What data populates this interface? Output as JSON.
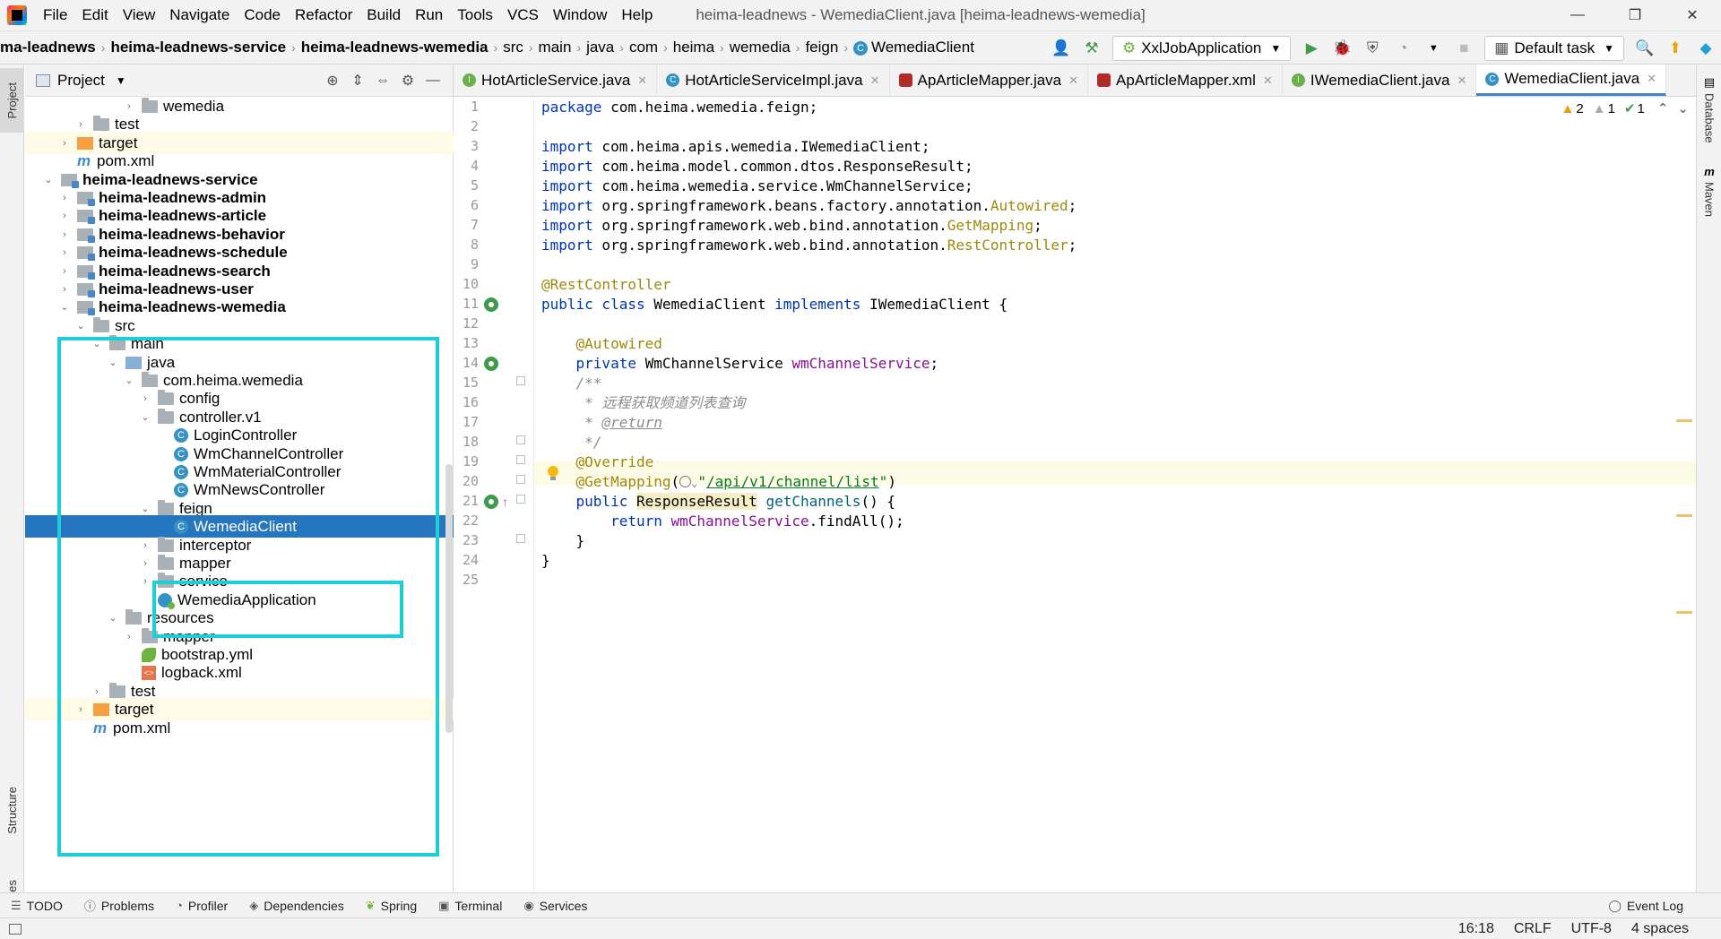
{
  "menubar": {
    "items": [
      "File",
      "Edit",
      "View",
      "Navigate",
      "Code",
      "Refactor",
      "Build",
      "Run",
      "Tools",
      "VCS",
      "Window",
      "Help"
    ],
    "window_title": "heima-leadnews - WemediaClient.java [heima-leadnews-wemedia]",
    "controls": [
      "—",
      "❐",
      "✕"
    ]
  },
  "navbar": {
    "breadcrumb": [
      "ma-leadnews",
      "heima-leadnews-service",
      "heima-leadnews-wemedia",
      "src",
      "main",
      "java",
      "com",
      "heima",
      "wemedia",
      "feign",
      "WemediaClient"
    ],
    "run_config": "XxlJobApplication",
    "task": "Default task"
  },
  "project": {
    "title": "Project",
    "tree": [
      {
        "label": "wemedia",
        "depth": 6,
        "type": "folder",
        "arrow": "›"
      },
      {
        "label": "test",
        "depth": 3,
        "type": "folder",
        "arrow": "›"
      },
      {
        "label": "target",
        "depth": 2,
        "type": "folder-orange",
        "arrow": "›",
        "highlight": true
      },
      {
        "label": "pom.xml",
        "depth": 2,
        "type": "maven",
        "arrow": ""
      },
      {
        "label": "heima-leadnews-service",
        "depth": 1,
        "type": "module",
        "arrow": "⌄",
        "bold": true
      },
      {
        "label": "heima-leadnews-admin",
        "depth": 2,
        "type": "module",
        "arrow": "›",
        "bold": true
      },
      {
        "label": "heima-leadnews-article",
        "depth": 2,
        "type": "module",
        "arrow": "›",
        "bold": true
      },
      {
        "label": "heima-leadnews-behavior",
        "depth": 2,
        "type": "module",
        "arrow": "›",
        "bold": true
      },
      {
        "label": "heima-leadnews-schedule",
        "depth": 2,
        "type": "module",
        "arrow": "›",
        "bold": true
      },
      {
        "label": "heima-leadnews-search",
        "depth": 2,
        "type": "module",
        "arrow": "›",
        "bold": true
      },
      {
        "label": "heima-leadnews-user",
        "depth": 2,
        "type": "module",
        "arrow": "›",
        "bold": true
      },
      {
        "label": "heima-leadnews-wemedia",
        "depth": 2,
        "type": "module",
        "arrow": "⌄",
        "bold": true
      },
      {
        "label": "src",
        "depth": 3,
        "type": "folder",
        "arrow": "⌄"
      },
      {
        "label": "main",
        "depth": 4,
        "type": "folder",
        "arrow": "⌄"
      },
      {
        "label": "java",
        "depth": 5,
        "type": "folder-blue",
        "arrow": "⌄"
      },
      {
        "label": "com.heima.wemedia",
        "depth": 6,
        "type": "folder",
        "arrow": "⌄"
      },
      {
        "label": "config",
        "depth": 7,
        "type": "folder",
        "arrow": "›"
      },
      {
        "label": "controller.v1",
        "depth": 7,
        "type": "folder",
        "arrow": "⌄"
      },
      {
        "label": "LoginController",
        "depth": 8,
        "type": "cls",
        "arrow": ""
      },
      {
        "label": "WmChannelController",
        "depth": 8,
        "type": "cls",
        "arrow": ""
      },
      {
        "label": "WmMaterialController",
        "depth": 8,
        "type": "cls",
        "arrow": ""
      },
      {
        "label": "WmNewsController",
        "depth": 8,
        "type": "cls",
        "arrow": ""
      },
      {
        "label": "feign",
        "depth": 7,
        "type": "folder",
        "arrow": "⌄"
      },
      {
        "label": "WemediaClient",
        "depth": 8,
        "type": "cls",
        "arrow": "",
        "selected": true
      },
      {
        "label": "interceptor",
        "depth": 7,
        "type": "folder",
        "arrow": "›"
      },
      {
        "label": "mapper",
        "depth": 7,
        "type": "folder",
        "arrow": "›"
      },
      {
        "label": "service",
        "depth": 7,
        "type": "folder",
        "arrow": "›"
      },
      {
        "label": "WemediaApplication",
        "depth": 7,
        "type": "springcls",
        "arrow": ""
      },
      {
        "label": "resources",
        "depth": 5,
        "type": "folder",
        "arrow": "⌄"
      },
      {
        "label": "mapper",
        "depth": 6,
        "type": "folder",
        "arrow": "›"
      },
      {
        "label": "bootstrap.yml",
        "depth": 6,
        "type": "yml",
        "arrow": ""
      },
      {
        "label": "logback.xml",
        "depth": 6,
        "type": "xml",
        "arrow": ""
      },
      {
        "label": "test",
        "depth": 4,
        "type": "folder",
        "arrow": "›"
      },
      {
        "label": "target",
        "depth": 3,
        "type": "folder-orange",
        "arrow": "›",
        "highlight": true
      },
      {
        "label": "pom.xml",
        "depth": 3,
        "type": "maven",
        "arrow": ""
      }
    ]
  },
  "editor": {
    "tabs": [
      {
        "label": "HotArticleService.java",
        "icon": "iface"
      },
      {
        "label": "HotArticleServiceImpl.java",
        "icon": "cls"
      },
      {
        "label": "ApArticleMapper.java",
        "icon": "bird"
      },
      {
        "label": "ApArticleMapper.xml",
        "icon": "bird"
      },
      {
        "label": "IWemediaClient.java",
        "icon": "iface"
      },
      {
        "label": "WemediaClient.java",
        "icon": "cls",
        "active": true
      }
    ],
    "inspections": {
      "warnings": "2",
      "weak": "1",
      "ok": "1"
    },
    "line_numbers": [
      "1",
      "2",
      "3",
      "4",
      "5",
      "6",
      "7",
      "8",
      "9",
      "10",
      "11",
      "12",
      "13",
      "14",
      "15",
      "16",
      "17",
      "18",
      "19",
      "20",
      "21",
      "22",
      "23",
      "24",
      "25"
    ],
    "code": [
      [
        {
          "t": "package com.heima.wemedia.feign;",
          "c": "kw-first"
        }
      ],
      [],
      [
        {
          "t": "import",
          "c": "kw"
        },
        {
          "t": " com.heima.apis.wemedia.IWemediaClient;",
          "c": ""
        }
      ],
      [
        {
          "t": "import",
          "c": "kw"
        },
        {
          "t": " com.heima.model.common.dtos.ResponseResult;",
          "c": ""
        }
      ],
      [
        {
          "t": "import",
          "c": "kw"
        },
        {
          "t": " com.heima.wemedia.service.WmChannelService;",
          "c": ""
        }
      ],
      [
        {
          "t": "import",
          "c": "kw"
        },
        {
          "t": " org.springframework.beans.factory.annotation.",
          "c": ""
        },
        {
          "t": "Autowired",
          "c": "ann"
        },
        {
          "t": ";",
          "c": ""
        }
      ],
      [
        {
          "t": "import",
          "c": "kw"
        },
        {
          "t": " org.springframework.web.bind.annotation.",
          "c": ""
        },
        {
          "t": "GetMapping",
          "c": "ann"
        },
        {
          "t": ";",
          "c": ""
        }
      ],
      [
        {
          "t": "import",
          "c": "kw"
        },
        {
          "t": " org.springframework.web.bind.annotation.",
          "c": ""
        },
        {
          "t": "RestController",
          "c": "ann"
        },
        {
          "t": ";",
          "c": ""
        }
      ],
      [],
      [
        {
          "t": "@RestController",
          "c": "ann"
        }
      ],
      [
        {
          "t": "public class",
          "c": "kw"
        },
        {
          "t": " WemediaClient ",
          "c": ""
        },
        {
          "t": "implements",
          "c": "kw"
        },
        {
          "t": " IWemediaClient {",
          "c": ""
        }
      ],
      [],
      [
        {
          "t": "    ",
          "c": ""
        },
        {
          "t": "@Autowired",
          "c": "ann"
        }
      ],
      [
        {
          "t": "    ",
          "c": ""
        },
        {
          "t": "private",
          "c": "kw"
        },
        {
          "t": " WmChannelService ",
          "c": ""
        },
        {
          "t": "wmChannelService",
          "c": "fld"
        },
        {
          "t": ";",
          "c": ""
        }
      ],
      [
        {
          "t": "    ",
          "c": ""
        },
        {
          "t": "/**",
          "c": "cmt"
        }
      ],
      [
        {
          "t": "     * 远程获取频道列表查询",
          "c": "cmt"
        }
      ],
      [
        {
          "t": "     * ",
          "c": "cmt"
        },
        {
          "t": "@return",
          "c": "doctag"
        }
      ],
      [
        {
          "t": "     */",
          "c": "cmt"
        }
      ],
      [
        {
          "t": "    ",
          "c": ""
        },
        {
          "t": "@Override",
          "c": "ann"
        }
      ],
      [
        {
          "t": "    ",
          "c": ""
        },
        {
          "t": "@GetMapping",
          "c": "ann"
        },
        {
          "t": "(",
          "c": ""
        },
        {
          "t": "WEB",
          "c": "webicon"
        },
        {
          "t": "\"",
          "c": "str"
        },
        {
          "t": "/api/v1/channel/list",
          "c": "strlink"
        },
        {
          "t": "\"",
          "c": "str"
        },
        {
          "t": ")",
          "c": ""
        }
      ],
      [
        {
          "t": "    ",
          "c": ""
        },
        {
          "t": "public",
          "c": "kw"
        },
        {
          "t": " ",
          "c": ""
        },
        {
          "t": "ResponseResult",
          "c": "typehl"
        },
        {
          "t": " ",
          "c": ""
        },
        {
          "t": "getChannels",
          "c": "mth"
        },
        {
          "t": "() {",
          "c": ""
        }
      ],
      [
        {
          "t": "        ",
          "c": ""
        },
        {
          "t": "return",
          "c": "kw"
        },
        {
          "t": " ",
          "c": ""
        },
        {
          "t": "wmChannelService",
          "c": "fld"
        },
        {
          "t": ".findAll();",
          "c": ""
        }
      ],
      [
        {
          "t": "    }",
          "c": ""
        }
      ],
      [
        {
          "t": "}",
          "c": ""
        }
      ],
      []
    ]
  },
  "left_strip": {
    "project": "Project",
    "structure": "Structure",
    "favorites": "Favorites"
  },
  "right_strip": {
    "database": "Database",
    "maven": "Maven"
  },
  "bottom_tabs": [
    "TODO",
    "Problems",
    "Profiler",
    "Dependencies",
    "Spring",
    "Terminal",
    "Services"
  ],
  "event_log": "Event Log",
  "status": {
    "position": "16:18",
    "line_sep": "CRLF",
    "encoding": "UTF-8",
    "indent": "4 spaces"
  },
  "colors": {
    "accent": "#2675bf",
    "annotation_box": "#1ccfd6",
    "keyword": "#0033b3",
    "annotation": "#9e880d",
    "field": "#871094",
    "string": "#067d17"
  }
}
